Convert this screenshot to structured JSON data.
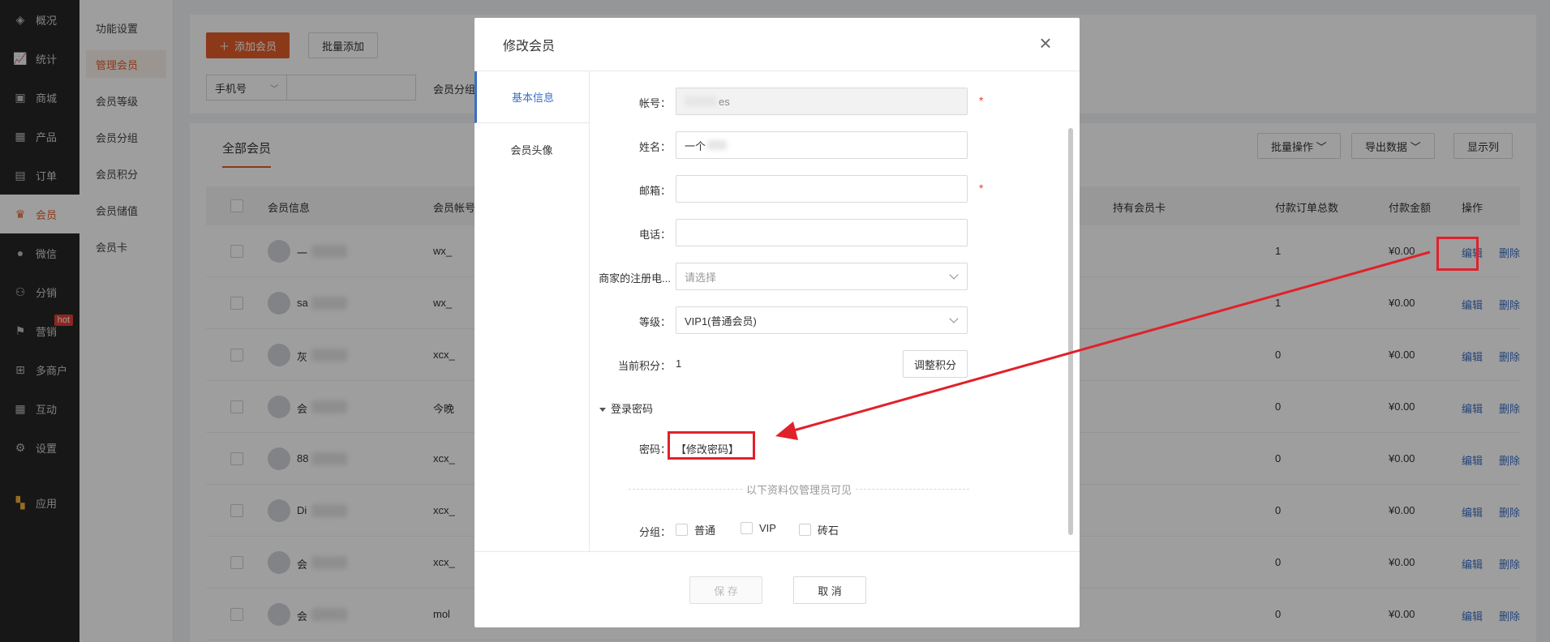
{
  "sidebar": {
    "items": [
      {
        "label": "概况",
        "icon": "layers-icon"
      },
      {
        "label": "统计",
        "icon": "chart-icon"
      },
      {
        "label": "商城",
        "icon": "store-icon"
      },
      {
        "label": "产品",
        "icon": "grid-icon"
      },
      {
        "label": "订单",
        "icon": "order-icon"
      },
      {
        "label": "会员",
        "icon": "crown-icon"
      },
      {
        "label": "微信",
        "icon": "wechat-icon"
      },
      {
        "label": "分销",
        "icon": "share-icon"
      },
      {
        "label": "营销",
        "icon": "flag-icon",
        "badge": "hot"
      },
      {
        "label": "多商户",
        "icon": "shop-icon"
      },
      {
        "label": "互动",
        "icon": "interaction-icon"
      },
      {
        "label": "设置",
        "icon": "gear-icon"
      },
      {
        "label": "应用",
        "icon": "apps-icon"
      }
    ]
  },
  "submenu": {
    "items": [
      "功能设置",
      "管理会员",
      "会员等级",
      "会员分组",
      "会员积分",
      "会员储值",
      "会员卡"
    ]
  },
  "toolbar": {
    "add_label": "添加会员",
    "batch_add_label": "批量添加",
    "filter_select": "手机号",
    "group_label": "会员分组"
  },
  "list": {
    "tab_label": "全部会员",
    "batch_ops_label": "批量操作",
    "export_label": "导出数据",
    "columns_label": "显示列",
    "headers": {
      "info": "会员信息",
      "account": "会员帐号",
      "card": "持有会员卡",
      "order_count": "付款订单总数",
      "amount": "付款金额",
      "ops": "操作"
    },
    "rows": [
      {
        "name": "一",
        "account": "wx_",
        "orders": "1",
        "amount": "¥0.00"
      },
      {
        "name": "sa",
        "account": "wx_",
        "orders": "1",
        "amount": "¥0.00"
      },
      {
        "name": "灰",
        "account": "xcx_",
        "orders": "0",
        "amount": "¥0.00"
      },
      {
        "name": "会",
        "account": "今晚",
        "orders": "0",
        "amount": "¥0.00"
      },
      {
        "name": "88",
        "account": "xcx_",
        "orders": "0",
        "amount": "¥0.00"
      },
      {
        "name": "Di",
        "account": "xcx_",
        "orders": "0",
        "amount": "¥0.00"
      },
      {
        "name": "会",
        "account": "xcx_",
        "orders": "0",
        "amount": "¥0.00"
      },
      {
        "name": "会",
        "account": "mol",
        "orders": "0",
        "amount": "¥0.00"
      }
    ],
    "edit_label": "编辑",
    "delete_label": "删除"
  },
  "modal": {
    "title": "修改会员",
    "tabs": [
      "基本信息",
      "会员头像"
    ],
    "fields": {
      "account_label": "帐号：",
      "account_value": "es",
      "name_label": "姓名：",
      "name_value": "一个",
      "email_label": "邮箱：",
      "phone_label": "电话：",
      "merchant_label": "商家的注册电...",
      "merchant_placeholder": "请选择",
      "level_label": "等级：",
      "level_value": "VIP1(普通会员)",
      "points_label": "当前积分：",
      "points_value": "1",
      "adjust_points_label": "调整积分",
      "login_section": "登录密码",
      "password_label": "密码：",
      "change_password_label": "【修改密码】",
      "admin_only_note": "以下资料仅管理员可见",
      "group_label": "分组：",
      "group_options": [
        "普通",
        "VIP",
        "砖石"
      ]
    },
    "save_label": "保 存",
    "cancel_label": "取 消"
  },
  "colors": {
    "accent": "#e35d2b",
    "link": "#3a6fc4",
    "highlight": "#e0212b"
  }
}
